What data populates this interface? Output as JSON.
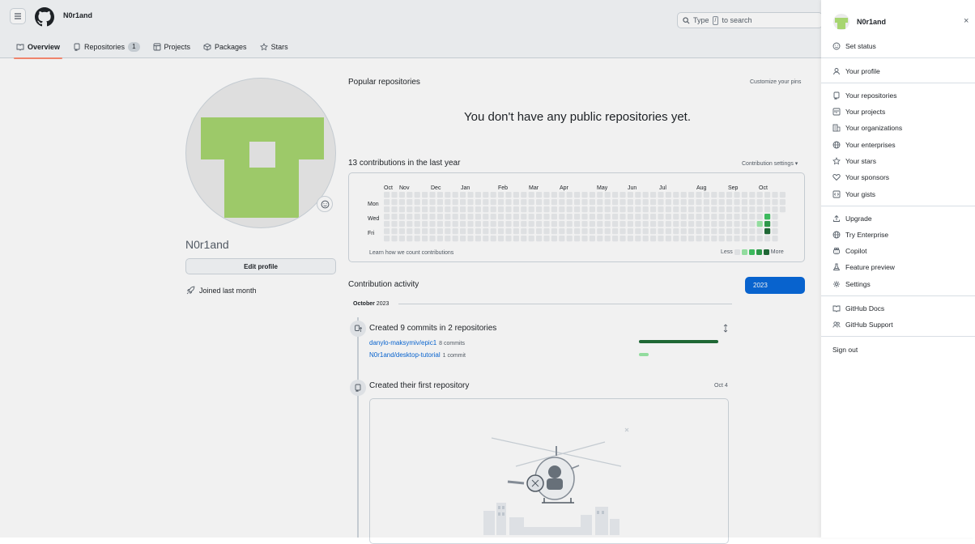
{
  "header": {
    "username": "N0r1and",
    "search_placeholder_pre": "Type",
    "search_key": "/",
    "search_placeholder_post": "to search"
  },
  "tabs": [
    {
      "label": "Overview"
    },
    {
      "label": "Repositories",
      "count": "1"
    },
    {
      "label": "Projects"
    },
    {
      "label": "Packages"
    },
    {
      "label": "Stars"
    }
  ],
  "profile": {
    "name": "N0r1and",
    "edit_label": "Edit profile",
    "joined": "Joined last month"
  },
  "popular": {
    "title": "Popular repositories",
    "customize": "Customize your pins",
    "empty": "You don't have any public repositories yet."
  },
  "contributions": {
    "title": "13 contributions in the last year",
    "settings": "Contribution settings ▾",
    "months": [
      "Oct",
      "Nov",
      "Dec",
      "Jan",
      "Feb",
      "Mar",
      "Apr",
      "May",
      "Jun",
      "Jul",
      "Aug",
      "Sep",
      "Oct"
    ],
    "days": [
      "Mon",
      "Wed",
      "Fri"
    ],
    "learn": "Learn how we count contributions",
    "less": "Less",
    "more": "More",
    "colors": {
      "empty": "#ebedf0",
      "l1": "#9be9a8",
      "l2": "#40c463",
      "l3": "#30a14e",
      "l4": "#216e39"
    }
  },
  "activity": {
    "title": "Contribution activity",
    "year": "2023",
    "month": "October",
    "month_year": "2023",
    "commits_title": "Created 9 commits in 2 repositories",
    "repos": [
      {
        "name": "danylo-maksymiv/epic1",
        "commits": "8 commits",
        "share": 0.89
      },
      {
        "name": "N0r1and/desktop-tutorial",
        "commits": "1 commit",
        "share": 0.11
      }
    ],
    "first_repo_title": "Created their first repository",
    "first_repo_date": "Oct 4"
  },
  "panel": {
    "username": "N0r1and",
    "close": "×",
    "items": [
      {
        "label": "Set status",
        "icon": "smiley-icon"
      },
      {
        "label": "Your profile",
        "icon": "person-icon"
      },
      {
        "label": "Your repositories",
        "icon": "repo-icon"
      },
      {
        "label": "Your projects",
        "icon": "project-icon"
      },
      {
        "label": "Your organizations",
        "icon": "organization-icon"
      },
      {
        "label": "Your enterprises",
        "icon": "globe-icon"
      },
      {
        "label": "Your stars",
        "icon": "star-icon"
      },
      {
        "label": "Your sponsors",
        "icon": "heart-icon"
      },
      {
        "label": "Your gists",
        "icon": "code-square-icon"
      },
      {
        "label": "Upgrade",
        "icon": "upload-icon"
      },
      {
        "label": "Try Enterprise",
        "icon": "globe-icon"
      },
      {
        "label": "Copilot",
        "icon": "copilot-icon"
      },
      {
        "label": "Feature preview",
        "icon": "beaker-icon"
      },
      {
        "label": "Settings",
        "icon": "gear-icon"
      },
      {
        "label": "GitHub Docs",
        "icon": "book-icon"
      },
      {
        "label": "GitHub Support",
        "icon": "people-icon"
      },
      {
        "label": "Sign out",
        "icon": ""
      }
    ]
  }
}
